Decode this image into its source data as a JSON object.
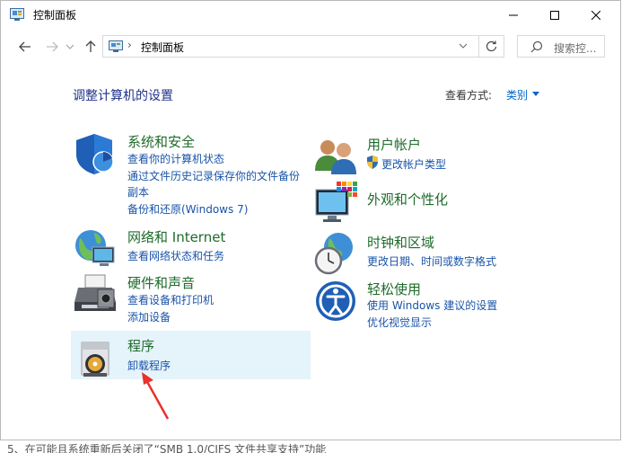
{
  "window": {
    "title": "控制面板"
  },
  "address": {
    "crumb": "控制面板"
  },
  "search": {
    "placeholder": "搜索控..."
  },
  "header": {
    "title": "调整计算机的设置",
    "view_label": "查看方式:",
    "view_value": "类别"
  },
  "categories": [
    {
      "title": "系统和安全",
      "icon": "shield-icon",
      "links": [
        "查看你的计算机状态",
        "通过文件历史记录保存你的文件备份",
        "副本",
        "备份和还原(Windows 7)"
      ]
    },
    {
      "title": "网络和 Internet",
      "icon": "network-globe-icon",
      "links": [
        "查看网络状态和任务"
      ]
    },
    {
      "title": "硬件和声音",
      "icon": "printer-icon",
      "links": [
        "查看设备和打印机",
        "添加设备"
      ]
    },
    {
      "title": "程序",
      "icon": "programs-disk-icon",
      "links": [
        "卸载程序"
      ]
    },
    {
      "title": "用户帐户",
      "icon": "users-icon",
      "links": [
        "更改帐户类型"
      ]
    },
    {
      "title": "外观和个性化",
      "icon": "monitor-palette-icon",
      "links": []
    },
    {
      "title": "时钟和区域",
      "icon": "clock-globe-icon",
      "links": [
        "更改日期、时间或数字格式"
      ]
    },
    {
      "title": "轻松使用",
      "icon": "ease-of-access-icon",
      "links": [
        "使用 Windows 建议的设置",
        "优化视觉显示"
      ]
    }
  ],
  "bottom_text": "5、在可能且系统重新后关闭了“SMB 1.0/CIFS 文件共享支持”功能",
  "colors": {
    "link": "#1a54a8",
    "category_title": "#1e6b2a",
    "heading": "#1e3287",
    "selected_bg": "#e5f3fb",
    "annotation": "#e8322b"
  }
}
